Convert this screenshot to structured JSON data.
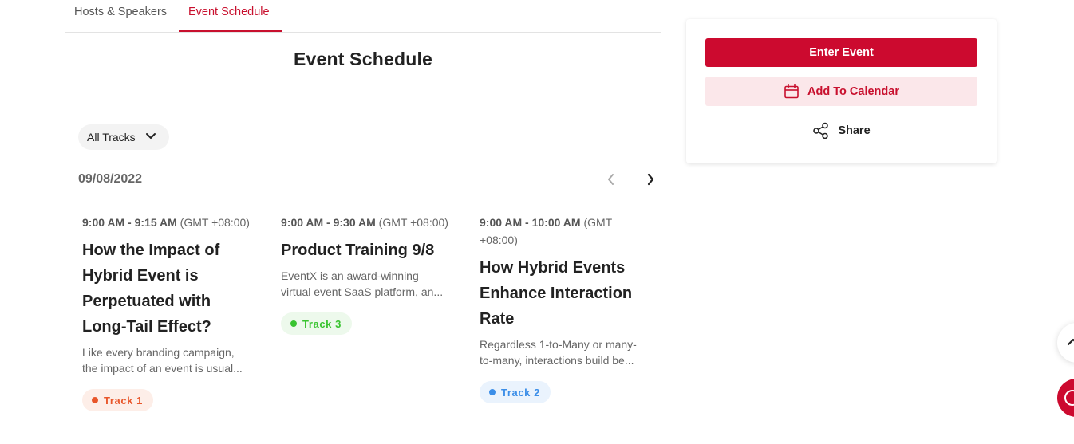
{
  "tabs": [
    {
      "label": "Hosts & Speakers",
      "active": false
    },
    {
      "label": "Event Schedule",
      "active": true
    }
  ],
  "page_title": "Event Schedule",
  "filter": {
    "label": "All Tracks"
  },
  "date": "09/08/2022",
  "sessions": [
    {
      "time": "9:00 AM - 9:15 AM",
      "tz": "(GMT +08:00)",
      "title": "How the Impact of Hybrid Event is Perpetuated with Long-Tail Effect?",
      "description": "Like every branding campaign, the impact of an event is usual...",
      "track": "Track 1"
    },
    {
      "time": "9:00 AM - 9:30 AM",
      "tz": "(GMT +08:00)",
      "title": "Product Training 9/8",
      "description": "EventX is an award-winning virtual event SaaS platform, an...",
      "track": "Track 3"
    },
    {
      "time": "9:00 AM - 10:00 AM",
      "tz": "(GMT +08:00)",
      "title": "How Hybrid Events Enhance Interaction Rate",
      "description": "Regardless 1-to-Many or many-to-many, interactions build be...",
      "track": "Track 2"
    }
  ],
  "panel": {
    "enter_label": "Enter Event",
    "calendar_label": "Add To Calendar",
    "share_label": "Share"
  },
  "colors": {
    "brand": "#cc0a2f",
    "track1": "#e8562a",
    "track2": "#3b8ee8",
    "track3": "#39c430"
  },
  "icons": [
    "chevron-down-icon",
    "chevron-left-icon",
    "chevron-right-icon",
    "calendar-icon",
    "share-icon",
    "arrow-up-icon",
    "help-icon"
  ]
}
